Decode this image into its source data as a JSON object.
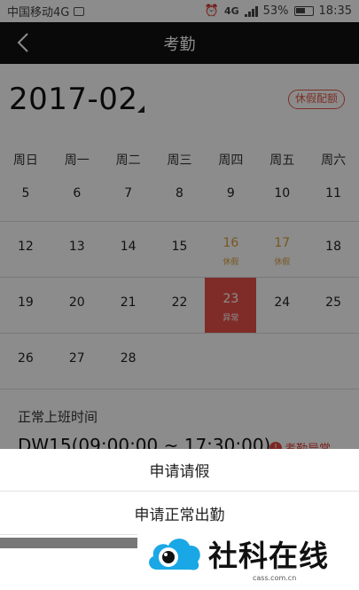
{
  "status_bar": {
    "carrier": "中国移动4G",
    "network": "4G",
    "battery": "53%",
    "time": "18:35"
  },
  "nav": {
    "title": "考勤"
  },
  "calendar": {
    "month": "2017-02",
    "leave_config_label": "休假配额",
    "weekdays": [
      "周日",
      "周一",
      "周二",
      "周三",
      "周四",
      "周五",
      "周六"
    ],
    "weeks": [
      [
        {
          "d": "5"
        },
        {
          "d": "6"
        },
        {
          "d": "7"
        },
        {
          "d": "8"
        },
        {
          "d": "9"
        },
        {
          "d": "10"
        },
        {
          "d": "11"
        }
      ],
      [
        {
          "d": "12"
        },
        {
          "d": "13"
        },
        {
          "d": "14"
        },
        {
          "d": "15"
        },
        {
          "d": "16",
          "tag": "休假",
          "kind": "holiday"
        },
        {
          "d": "17",
          "tag": "休假",
          "kind": "holiday"
        },
        {
          "d": "18"
        }
      ],
      [
        {
          "d": "19"
        },
        {
          "d": "20"
        },
        {
          "d": "21"
        },
        {
          "d": "22"
        },
        {
          "d": "23",
          "tag": "异常",
          "kind": "abnormal"
        },
        {
          "d": "24"
        },
        {
          "d": "25"
        }
      ],
      [
        {
          "d": "26"
        },
        {
          "d": "27"
        },
        {
          "d": "28"
        },
        {
          "d": ""
        },
        {
          "d": ""
        },
        {
          "d": ""
        },
        {
          "d": ""
        }
      ]
    ]
  },
  "detail": {
    "section_label": "正常上班时间",
    "shift": "DW15(09:00:00 ~ 17:30:00)",
    "status": "考勤异常"
  },
  "sheet": {
    "option1": "申请请假",
    "option2": "申请正常出勤"
  },
  "watermark": {
    "text": "社科在线",
    "domain": "cass.com.cn"
  },
  "colors": {
    "accent": "#e8504a",
    "holiday": "#d99f3b",
    "navbar": "#111111"
  }
}
